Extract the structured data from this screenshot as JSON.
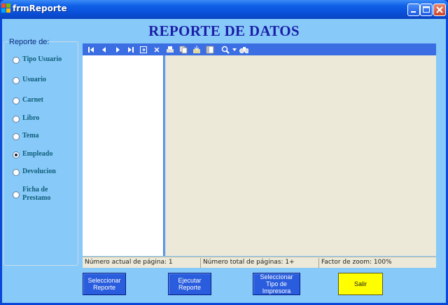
{
  "window": {
    "title": "frmReporte"
  },
  "header": {
    "title": "REPORTE DE DATOS"
  },
  "report_group": {
    "legend": "Reporte de:",
    "options": [
      {
        "label": "Tipo Usuario",
        "selected": false
      },
      {
        "label": "Usuario",
        "selected": false
      },
      {
        "label": "Carnet",
        "selected": false
      },
      {
        "label": "Libro",
        "selected": false
      },
      {
        "label": "Tema",
        "selected": false
      },
      {
        "label": "Empleado",
        "selected": true
      },
      {
        "label": "Devolucion",
        "selected": false
      },
      {
        "label": "Ficha de Prestamo",
        "selected": false
      }
    ]
  },
  "viewer": {
    "toolbar_icons": [
      "first-page-icon",
      "previous-page-icon",
      "next-page-icon",
      "last-page-icon",
      "go-to-page-icon",
      "stop-icon",
      "print-icon",
      "copy-icon",
      "export-icon",
      "toggle-tree-icon",
      "zoom-icon",
      "zoom-dropdown-icon",
      "find-icon"
    ],
    "status": {
      "current_page": "Número actual de página: 1",
      "total_pages": "Número total de páginas: 1+",
      "zoom": "Factor de zoom: 100%"
    }
  },
  "buttons": {
    "select_report": "Seleccionar Reporte",
    "run_report": "Ejecutar Reporte",
    "select_printer": "Seleccionar Tipo de Impresora",
    "exit": "Salir"
  },
  "colors": {
    "titlebar": "#0a4fd8",
    "client_background": "#87c9f8",
    "title_text": "#1a1ea8",
    "button_blue": "#2a5ddd",
    "button_yellow": "#ffff00"
  }
}
